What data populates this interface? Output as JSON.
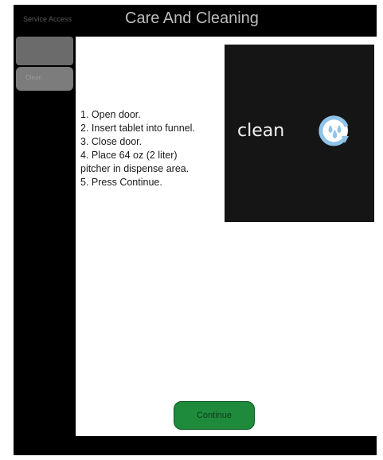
{
  "header": {
    "back_label": "Service Access",
    "title": "Care And Cleaning"
  },
  "sidebar": {
    "items": [
      {
        "label": ""
      },
      {
        "label": "Clean"
      }
    ]
  },
  "instructions": {
    "steps": [
      "1. Open door.",
      "2. Insert tablet into funnel.",
      "3. Close door.",
      "4. Place 64 oz (2 liter)",
      "pitcher in dispense area.",
      "5. Press Continue."
    ]
  },
  "clean_panel": {
    "label": "clean",
    "icon": "clean-cycle-icon"
  },
  "actions": {
    "continue_label": "Continue"
  },
  "colors": {
    "continue_button": "#1e8a3c",
    "clean_icon": "#8fc3e8",
    "panel_background": "#151515"
  }
}
